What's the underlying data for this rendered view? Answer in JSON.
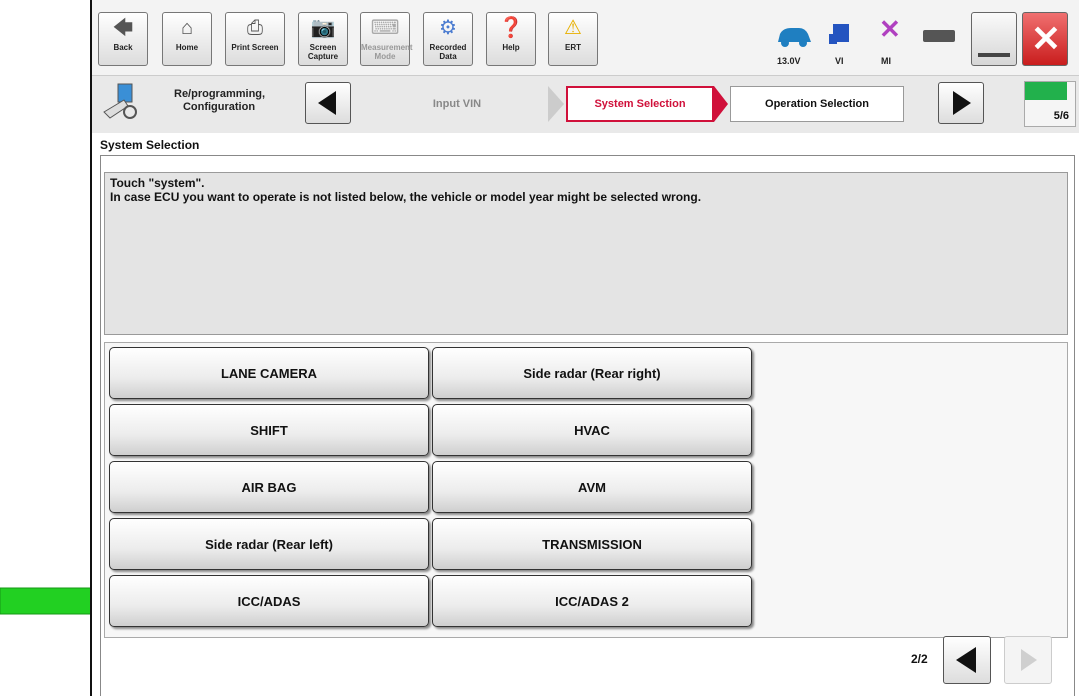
{
  "toolbar": {
    "back_label": "Back",
    "home_label": "Home",
    "print_label": "Print Screen",
    "screen_capture_label": "Screen Capture",
    "measurement_label": "Measurement Mode",
    "recorded_label": "Recorded Data",
    "help_label": "Help",
    "ert_label": "ERT",
    "voltage": "13.0V",
    "vi_label": "VI",
    "mi_label": "MI"
  },
  "nav": {
    "section_label": "Re/programming, Configuration",
    "steps": [
      {
        "label": "Input VIN",
        "state": "done"
      },
      {
        "label": "System Selection",
        "state": "active"
      },
      {
        "label": "Operation Selection",
        "state": "next"
      }
    ],
    "progress": "5/6",
    "progress_fraction": 0.83,
    "progress_color": "#22b14c"
  },
  "page": {
    "title": "System Selection",
    "message_line1": "Touch \"system\".",
    "message_line2": "In case ECU you want to operate is not listed below, the vehicle or model year might be selected wrong."
  },
  "systems": [
    "LANE CAMERA",
    "Side radar (Rear right)",
    "SHIFT",
    "HVAC",
    "AIR BAG",
    "AVM",
    "Side radar (Rear left)",
    "TRANSMISSION",
    "ICC/ADAS",
    "ICC/ADAS 2"
  ],
  "pager": {
    "label": "2/2"
  },
  "colors": {
    "accent_red": "#d0103a",
    "pointer_green": "#22d022",
    "close_red": "#e03030"
  }
}
